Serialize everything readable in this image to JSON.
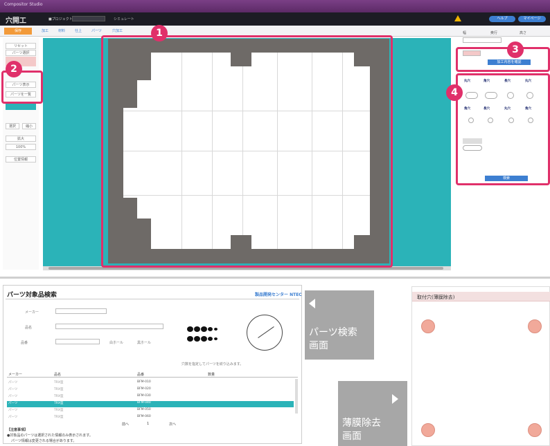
{
  "header": {
    "app_name": "穴開工",
    "brand_line": "Compositor Studio",
    "toolbar_items": [
      "■プロジェクト",
      "シミュレート"
    ],
    "right_pills": [
      "ヘルプ",
      "マイページ"
    ]
  },
  "menu": {
    "primary_button": "保存",
    "tabs": [
      "加工",
      "材料",
      "仕上",
      "パーツ",
      "穴加工"
    ]
  },
  "left_panel": {
    "items": [
      "リセット",
      "パーツ選択",
      "パーツ表示",
      "パーツを一覧",
      "削除",
      "選択",
      "縮小",
      "拡大",
      "100%",
      "位置情報"
    ]
  },
  "right_panel": {
    "labels": [
      "幅",
      "奥行",
      "高さ"
    ],
    "button_top": "加工内容を確認",
    "search_button": "検索",
    "shape_labels": [
      "丸穴",
      "角穴",
      "長穴",
      "丸穴",
      "角穴",
      "長穴",
      "丸穴",
      "角穴"
    ]
  },
  "badges": [
    "1",
    "2",
    "3",
    "4"
  ],
  "parts_search": {
    "title": "パーツ対象品検索",
    "brand": "製品開発センター NTEC",
    "fields": [
      "メーカー",
      "品名",
      "品番"
    ],
    "radios": [
      "白ホール",
      "黒ホール"
    ],
    "hint": "穴数を指定してパーツを絞り込みます。",
    "columns": [
      "メーカー",
      "品名",
      "品番",
      "数量"
    ],
    "rows": [
      {
        "maker": "パーツ",
        "name": "TRX型",
        "code": "BFM-010"
      },
      {
        "maker": "パーツ",
        "name": "TRX型",
        "code": "BFM-020"
      },
      {
        "maker": "パーツ",
        "name": "TRX型",
        "code": "BFM-030"
      },
      {
        "maker": "パーツ",
        "name": "TRX型",
        "code": "BFM-040"
      },
      {
        "maker": "パーツ",
        "name": "TRX型",
        "code": "BFM-050"
      },
      {
        "maker": "パーツ",
        "name": "TRX型",
        "code": "BFM-060"
      }
    ],
    "pager": [
      "前へ",
      "1",
      "次へ"
    ],
    "notes_title": "【注意事項】",
    "notes": [
      "●対象品のパーツは選択された情報のみ表示されます。",
      "パーツ情報は変更される場合があります。"
    ]
  },
  "nav_tiles": {
    "left": {
      "line1": "パーツ検索",
      "line2": "画面"
    },
    "right": {
      "line1": "薄膜除去",
      "line2": "画面"
    }
  },
  "hole_panel": {
    "title": "取付穴(薄膜除去)"
  },
  "colors": {
    "accent_magenta": "#e0306a",
    "teal": "#2bb3b8",
    "header_purple": "#6a3476",
    "blue": "#3d7fd1",
    "hole_fill": "#f1a99a"
  }
}
